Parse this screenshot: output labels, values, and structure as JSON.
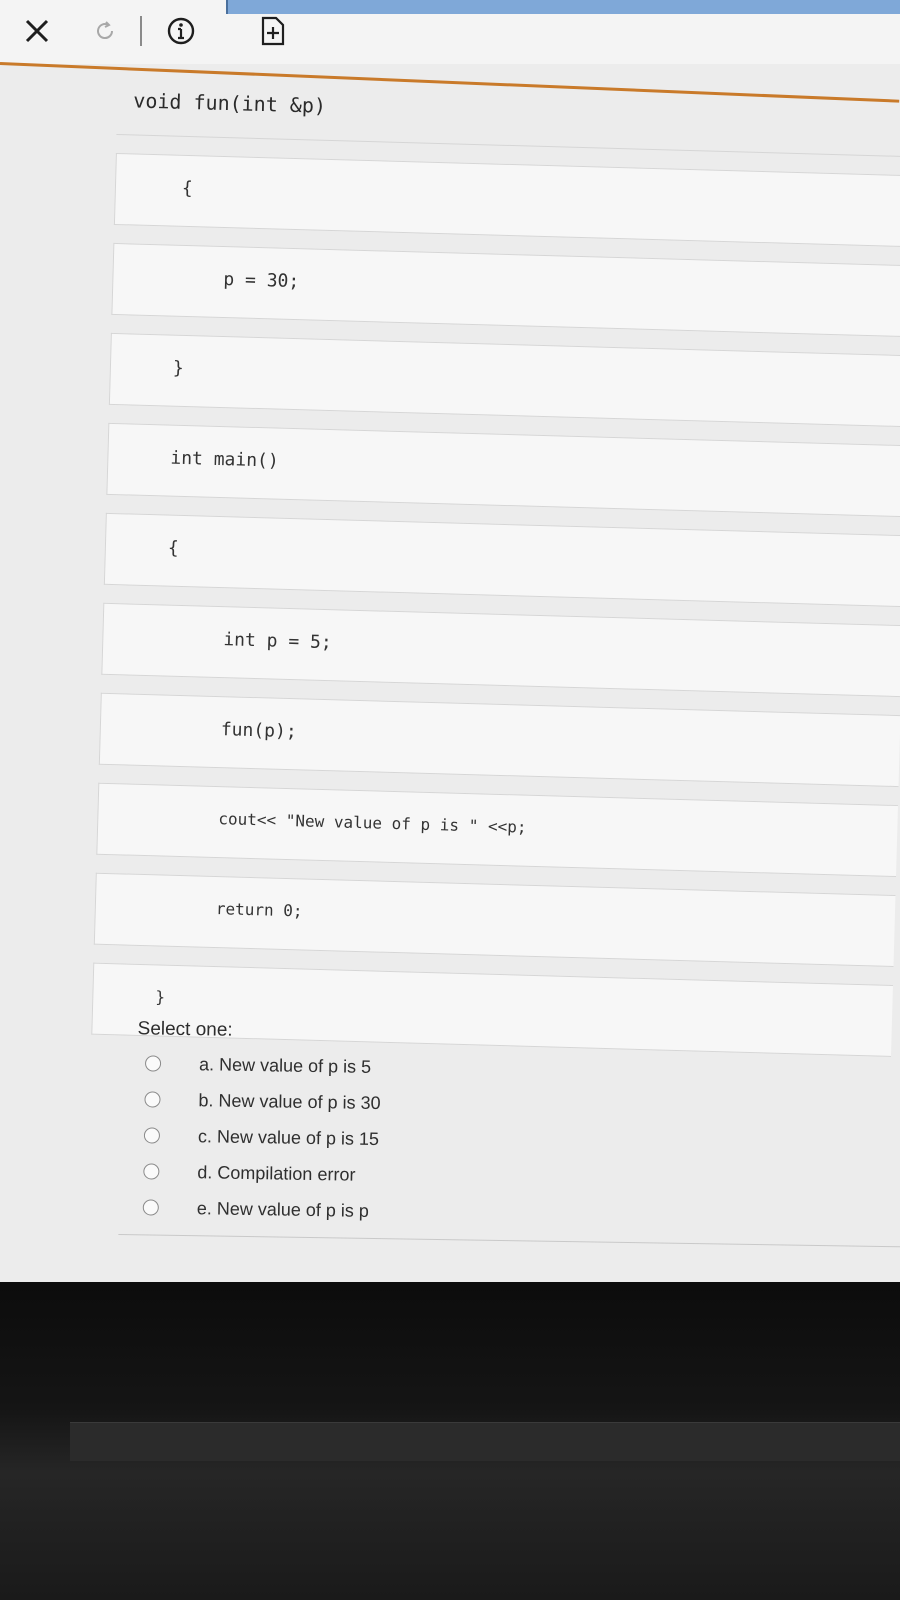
{
  "toolbar": {
    "close_icon": "close-icon",
    "reload_icon": "reload-icon",
    "info_icon": "info-icon",
    "add_icon": "add-page-icon"
  },
  "code_lines": [
    "void fun(int &p)",
    "{",
    "p = 30;",
    "}",
    "int main()",
    "{",
    "int p = 5;",
    "fun(p);",
    "cout<< \"New value of p is \" <<p;",
    "return 0;",
    "}"
  ],
  "question": {
    "select_label": "Select one:",
    "options": [
      "a. New value of p is 5",
      "b. New value of p is 30",
      "c. New value of p is 15",
      "d. Compilation error",
      "e. New value of p is p"
    ]
  },
  "colors": {
    "accent": "#c97a2a",
    "tab_blue": "#7fa8d8"
  }
}
